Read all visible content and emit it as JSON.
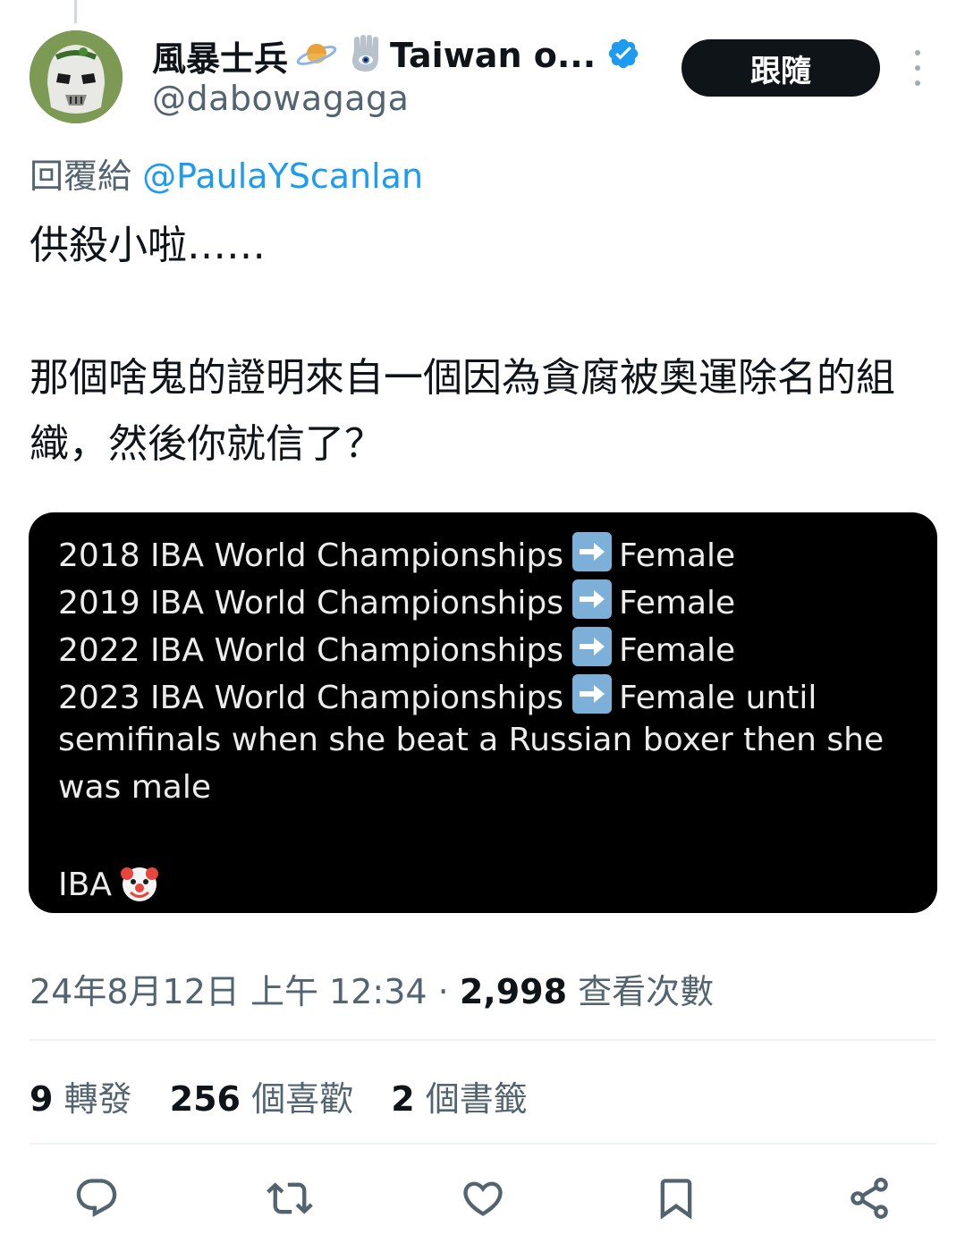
{
  "author": {
    "display_name": "風暴士兵",
    "name_suffix": "Taiwan o...",
    "handle": "@dabowagaga",
    "verified": true
  },
  "header": {
    "follow_label": "跟隨"
  },
  "reply": {
    "prefix": "回覆給",
    "mention": "@PaulaYScanlan"
  },
  "tweet": {
    "line1": "供殺小啦……",
    "line2": "那個啥鬼的證明來自一個因為貪腐被奧運除名的組織，然後你就信了？"
  },
  "media": {
    "lines": [
      {
        "left": "2018 IBA World Championships",
        "right": "Female"
      },
      {
        "left": "2019 IBA World Championships",
        "right": "Female"
      },
      {
        "left": "2022 IBA World Championships",
        "right": "Female"
      },
      {
        "left": "2023 IBA World Championships",
        "right": "Female until"
      }
    ],
    "wrap1": "semifinals when she beat a Russian boxer then she",
    "wrap2": "was male",
    "footer": "IBA"
  },
  "meta": {
    "timestamp": "24年8月12日 上午 12:34",
    "separator": "·",
    "views_count": "2,998",
    "views_label": "查看次數"
  },
  "stats": {
    "retweets_count": "9",
    "retweets_label": "轉發",
    "likes_count": "256",
    "likes_label": "個喜歡",
    "bookmarks_count": "2",
    "bookmarks_label": "個書籤"
  },
  "icons": {
    "reply": "reply-icon",
    "retweet": "retweet-icon",
    "like": "heart-icon",
    "bookmark": "bookmark-icon",
    "share": "share-icon",
    "verified": "verified-badge-icon"
  },
  "colors": {
    "accent": "#1d9bf0",
    "text": "#0f1419",
    "secondary": "#536471",
    "follow_bg": "#0f1419"
  }
}
